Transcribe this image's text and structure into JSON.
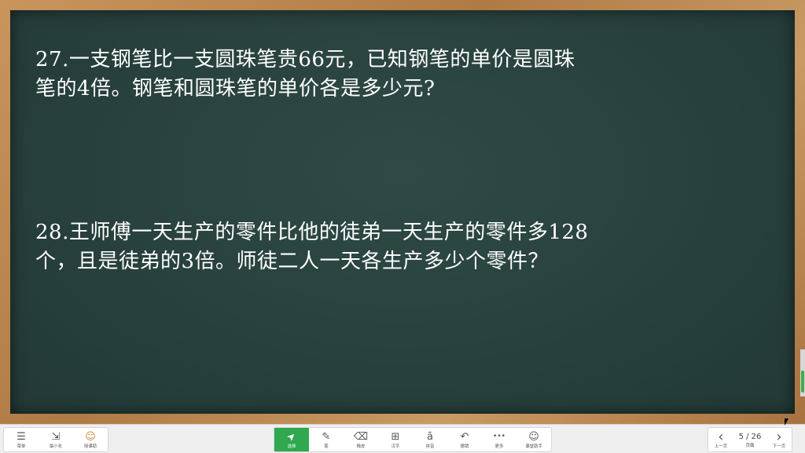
{
  "questions": [
    {
      "line1": "27.一支钢笔比一支圆珠笔贵66元，已知钢笔的单价是圆珠",
      "line2": "笔的4倍。钢笔和圆珠笔的单价各是多少元?"
    },
    {
      "line1": "28.王师傅一天生产的零件比他的徒弟一天生产的零件多128",
      "line2": "个，且是徒弟的3倍。师徒二人一天各生产多少个零件？"
    }
  ],
  "toolbar": {
    "left": [
      {
        "icon": "menu-icon",
        "glyph": "☰",
        "label": "菜单"
      },
      {
        "icon": "minimize-icon",
        "glyph": "⇲",
        "label": "最小化"
      },
      {
        "icon": "avatar-icon",
        "glyph": "☺",
        "label": "授课助"
      }
    ],
    "middle": [
      {
        "icon": "cursor-arrow-icon",
        "glyph": "➤",
        "label": "选择"
      },
      {
        "icon": "pen-icon",
        "glyph": "✎",
        "label": "笔"
      },
      {
        "icon": "eraser-icon",
        "glyph": "⌫",
        "label": "橡皮"
      },
      {
        "icon": "grid-icon",
        "glyph": "⊞",
        "label": "汉字"
      },
      {
        "icon": "pinyin-icon",
        "glyph": "ā",
        "label": "拼音"
      },
      {
        "icon": "undo-icon",
        "glyph": "↶",
        "label": "撤销"
      },
      {
        "icon": "more-icon",
        "glyph": "•••",
        "label": "更多"
      },
      {
        "icon": "assistant-icon",
        "glyph": "☺",
        "label": "课堂助手"
      }
    ],
    "right": {
      "prev": {
        "icon": "chevron-left-icon",
        "glyph": "‹",
        "label": "上一页"
      },
      "page": {
        "current": "5 / 26",
        "label": "页面"
      },
      "next": {
        "icon": "chevron-right-icon",
        "glyph": "›",
        "label": "下一页"
      }
    }
  },
  "colors": {
    "board": "#27403c",
    "frame": "#b07a45",
    "accent": "#2fa84f"
  }
}
